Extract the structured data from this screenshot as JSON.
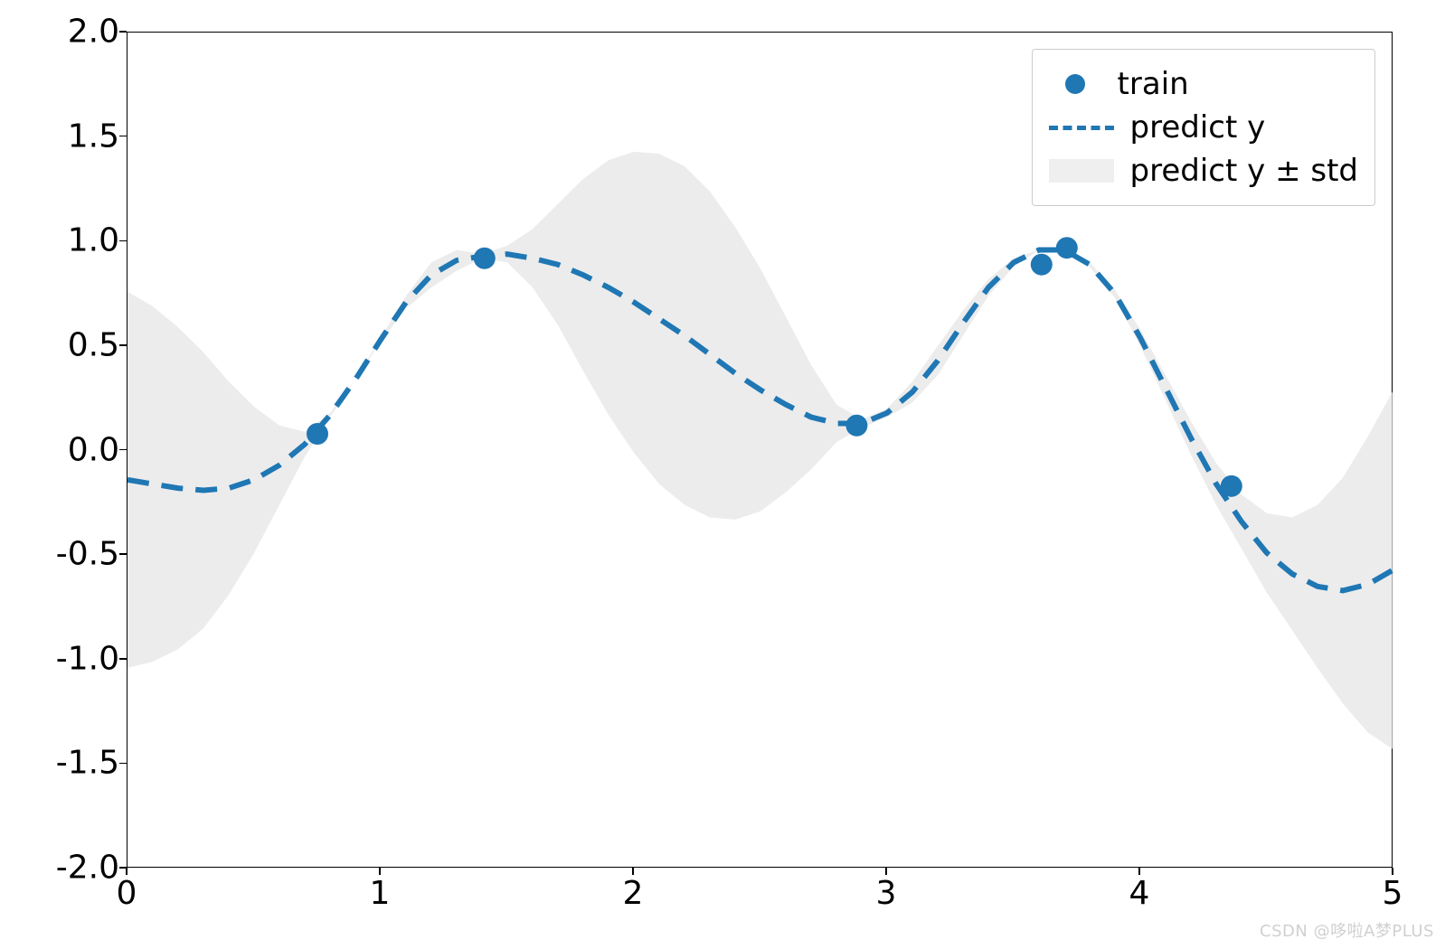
{
  "chart_data": {
    "type": "line",
    "xlim": [
      0,
      5
    ],
    "ylim": [
      -2,
      2
    ],
    "xticks": [
      0,
      1,
      2,
      3,
      4,
      5
    ],
    "yticks": [
      -2.0,
      -1.5,
      -1.0,
      -0.5,
      0.0,
      0.5,
      1.0,
      1.5,
      2.0
    ],
    "title": "",
    "xlabel": "",
    "ylabel": "",
    "legend_position": "upper right",
    "series": [
      {
        "name": "train",
        "type": "scatter",
        "color": "#1f77b4",
        "x": [
          0.75,
          1.41,
          2.88,
          3.61,
          3.71,
          4.36
        ],
        "y": [
          0.08,
          0.92,
          0.12,
          0.89,
          0.97,
          -0.17
        ]
      },
      {
        "name": "predict y",
        "type": "dashed-line",
        "color": "#1f77b4",
        "x": [
          0.0,
          0.1,
          0.2,
          0.3,
          0.4,
          0.5,
          0.6,
          0.7,
          0.8,
          0.9,
          1.0,
          1.1,
          1.2,
          1.3,
          1.4,
          1.5,
          1.6,
          1.7,
          1.8,
          1.9,
          2.0,
          2.1,
          2.2,
          2.3,
          2.4,
          2.5,
          2.6,
          2.7,
          2.8,
          2.9,
          3.0,
          3.1,
          3.2,
          3.3,
          3.4,
          3.5,
          3.6,
          3.7,
          3.8,
          3.9,
          4.0,
          4.1,
          4.2,
          4.3,
          4.4,
          4.5,
          4.6,
          4.7,
          4.8,
          4.9,
          5.0
        ],
        "y": [
          -0.14,
          -0.16,
          -0.18,
          -0.19,
          -0.18,
          -0.14,
          -0.07,
          0.03,
          0.17,
          0.34,
          0.53,
          0.71,
          0.84,
          0.91,
          0.93,
          0.94,
          0.92,
          0.89,
          0.84,
          0.78,
          0.71,
          0.63,
          0.55,
          0.46,
          0.37,
          0.29,
          0.22,
          0.16,
          0.13,
          0.13,
          0.18,
          0.28,
          0.43,
          0.61,
          0.78,
          0.9,
          0.96,
          0.96,
          0.89,
          0.75,
          0.54,
          0.3,
          0.06,
          -0.16,
          -0.34,
          -0.49,
          -0.59,
          -0.65,
          -0.67,
          -0.64,
          -0.57
        ]
      },
      {
        "name": "predict y ± std",
        "type": "fill",
        "color": "#e5e5e5",
        "x": [
          0.0,
          0.1,
          0.2,
          0.3,
          0.4,
          0.5,
          0.6,
          0.7,
          0.8,
          0.9,
          1.0,
          1.1,
          1.2,
          1.3,
          1.4,
          1.5,
          1.6,
          1.7,
          1.8,
          1.9,
          2.0,
          2.1,
          2.2,
          2.3,
          2.4,
          2.5,
          2.6,
          2.7,
          2.8,
          2.9,
          3.0,
          3.1,
          3.2,
          3.3,
          3.4,
          3.5,
          3.6,
          3.7,
          3.8,
          3.9,
          4.0,
          4.1,
          4.2,
          4.3,
          4.4,
          4.5,
          4.6,
          4.7,
          4.8,
          4.9,
          5.0
        ],
        "y_upper": [
          0.76,
          0.69,
          0.59,
          0.47,
          0.33,
          0.21,
          0.12,
          0.09,
          0.18,
          0.34,
          0.54,
          0.74,
          0.9,
          0.96,
          0.94,
          0.98,
          1.06,
          1.18,
          1.3,
          1.39,
          1.43,
          1.42,
          1.36,
          1.24,
          1.07,
          0.87,
          0.64,
          0.41,
          0.22,
          0.15,
          0.2,
          0.33,
          0.5,
          0.67,
          0.82,
          0.92,
          0.96,
          0.97,
          0.9,
          0.77,
          0.58,
          0.36,
          0.14,
          -0.06,
          -0.21,
          -0.3,
          -0.32,
          -0.26,
          -0.13,
          0.07,
          0.29
        ],
        "y_lower": [
          -1.04,
          -1.01,
          -0.95,
          -0.85,
          -0.69,
          -0.49,
          -0.26,
          -0.03,
          0.16,
          0.34,
          0.52,
          0.68,
          0.78,
          0.86,
          0.92,
          0.9,
          0.78,
          0.6,
          0.38,
          0.17,
          -0.01,
          -0.16,
          -0.26,
          -0.32,
          -0.33,
          -0.29,
          -0.2,
          -0.09,
          0.04,
          0.11,
          0.16,
          0.23,
          0.36,
          0.55,
          0.74,
          0.88,
          0.96,
          0.95,
          0.88,
          0.73,
          0.5,
          0.24,
          -0.02,
          -0.26,
          -0.47,
          -0.68,
          -0.86,
          -1.04,
          -1.21,
          -1.35,
          -1.43
        ]
      }
    ],
    "legend": [
      "train",
      "predict y",
      "predict y ± std"
    ]
  },
  "watermark": "CSDN @哆啦A梦PLUS"
}
